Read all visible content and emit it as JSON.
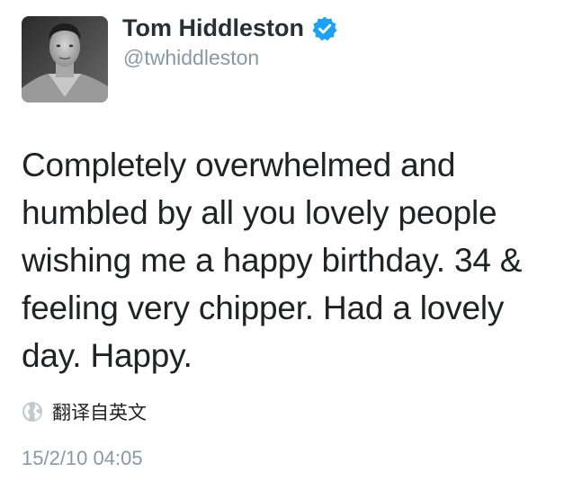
{
  "author": {
    "display_name": "Tom Hiddleston",
    "handle": "@twhiddleston",
    "verified": true
  },
  "tweet": {
    "text": "Completely overwhelmed and humbled by all you lovely people wishing me a happy birthday. 34 & feeling very chipper. Had a lovely day. Happy.",
    "translate_label": "翻译自英文",
    "timestamp": "15/2/10 04:05"
  },
  "icons": {
    "verified": "verified-badge-icon",
    "translate": "globe-icon"
  },
  "colors": {
    "verified_blue": "#1da1f2",
    "secondary_text": "#8899a6"
  }
}
